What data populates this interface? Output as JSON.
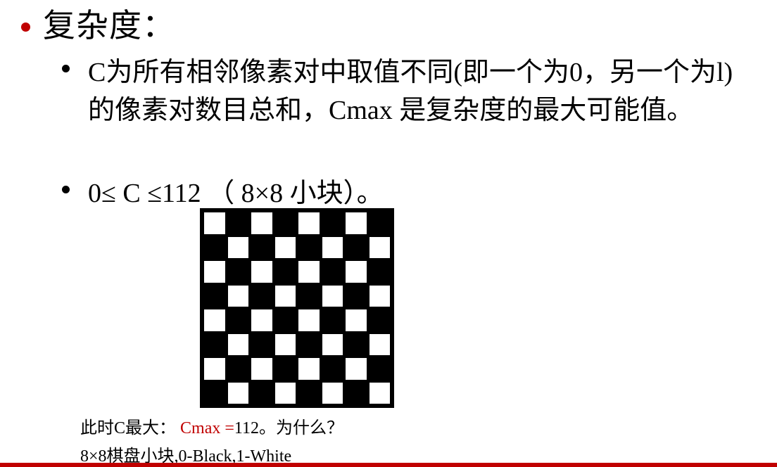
{
  "colors": {
    "accent": "#c00000",
    "black": "#000000",
    "white": "#ffffff"
  },
  "title": "复杂度：",
  "bullets": [
    "C为所有相邻像素对中取值不同(即一个为0，另一个为l)的像素对数目总和，Cmax 是复杂度的最大可能值。",
    "0≤ C ≤112 （ 8×8 小块）。"
  ],
  "board": {
    "rows": 8,
    "cols": 8,
    "pattern": "checkerboard",
    "top_left": "white"
  },
  "caption": {
    "line1_prefix": "此时C最大：",
    "line1_highlight": "Cmax =",
    "line1_suffix": "112。为什么？",
    "line2": "8×8棋盘小块,0-Black,1-White"
  }
}
